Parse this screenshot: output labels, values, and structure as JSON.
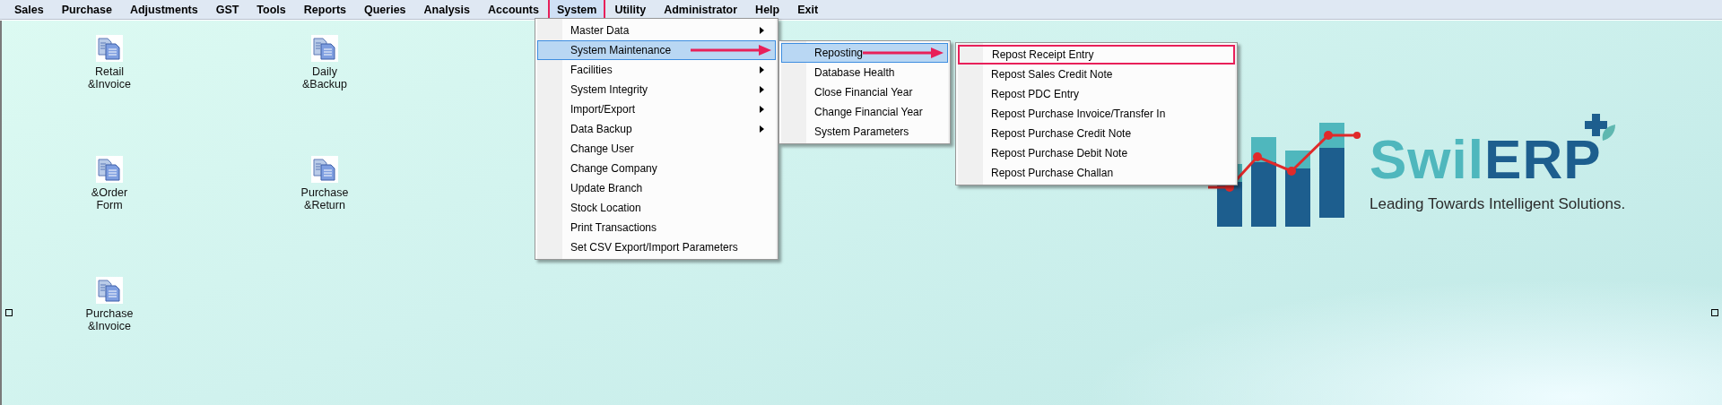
{
  "menubar": [
    {
      "label": "Sales",
      "selected": false,
      "annotated": false
    },
    {
      "label": "Purchase",
      "selected": false,
      "annotated": false
    },
    {
      "label": "Adjustments",
      "selected": false,
      "annotated": false
    },
    {
      "label": "GST",
      "selected": false,
      "annotated": false
    },
    {
      "label": "Tools",
      "selected": false,
      "annotated": false
    },
    {
      "label": "Reports",
      "selected": false,
      "annotated": false
    },
    {
      "label": "Queries",
      "selected": false,
      "annotated": false
    },
    {
      "label": "Analysis",
      "selected": false,
      "annotated": false
    },
    {
      "label": "Accounts",
      "selected": false,
      "annotated": false
    },
    {
      "label": "System",
      "selected": true,
      "annotated": true
    },
    {
      "label": "Utility",
      "selected": false,
      "annotated": false
    },
    {
      "label": "Administrator",
      "selected": false,
      "annotated": false
    },
    {
      "label": "Help",
      "selected": false,
      "annotated": false
    },
    {
      "label": "Exit",
      "selected": false,
      "annotated": false
    }
  ],
  "menus": [
    {
      "items": [
        {
          "label": "Master Data",
          "submenu": true,
          "selected": false,
          "annotated": false
        },
        {
          "label": "System Maintenance",
          "submenu": true,
          "selected": true,
          "annotated": false
        },
        {
          "label": "Facilities",
          "submenu": true,
          "selected": false,
          "annotated": false
        },
        {
          "label": "System Integrity",
          "submenu": true,
          "selected": false,
          "annotated": false
        },
        {
          "label": "Import/Export",
          "submenu": true,
          "selected": false,
          "annotated": false
        },
        {
          "label": "Data Backup",
          "submenu": true,
          "selected": false,
          "annotated": false
        },
        {
          "label": "Change User",
          "submenu": false,
          "selected": false,
          "annotated": false
        },
        {
          "label": "Change Company",
          "submenu": false,
          "selected": false,
          "annotated": false
        },
        {
          "label": "Update Branch",
          "submenu": false,
          "selected": false,
          "annotated": false
        },
        {
          "label": "Stock Location",
          "submenu": false,
          "selected": false,
          "annotated": false
        },
        {
          "label": "Print Transactions",
          "submenu": false,
          "selected": false,
          "annotated": false
        },
        {
          "label": "Set CSV Export/Import Parameters",
          "submenu": false,
          "selected": false,
          "annotated": false
        }
      ]
    },
    {
      "items": [
        {
          "label": "Reposting",
          "submenu": true,
          "selected": true,
          "annotated": false
        },
        {
          "label": "Database Health",
          "submenu": false,
          "selected": false,
          "annotated": false
        },
        {
          "label": "Close Financial Year",
          "submenu": false,
          "selected": false,
          "annotated": false
        },
        {
          "label": "Change Financial Year",
          "submenu": false,
          "selected": false,
          "annotated": false
        },
        {
          "label": "System Parameters",
          "submenu": false,
          "selected": false,
          "annotated": false
        }
      ]
    },
    {
      "items": [
        {
          "label": "Repost Receipt Entry",
          "submenu": false,
          "selected": false,
          "annotated": true
        },
        {
          "label": "Repost Sales Credit Note",
          "submenu": false,
          "selected": false,
          "annotated": false
        },
        {
          "label": "Repost PDC Entry",
          "submenu": false,
          "selected": false,
          "annotated": false
        },
        {
          "label": "Repost Purchase Invoice/Transfer In",
          "submenu": false,
          "selected": false,
          "annotated": false
        },
        {
          "label": "Repost Purchase Credit Note",
          "submenu": false,
          "selected": false,
          "annotated": false
        },
        {
          "label": "Repost Purchase Debit Note",
          "submenu": false,
          "selected": false,
          "annotated": false
        },
        {
          "label": "Repost Purchase Challan",
          "submenu": false,
          "selected": false,
          "annotated": false
        }
      ]
    }
  ],
  "desktop_icons": [
    {
      "label": "Retail\n&Invoice"
    },
    {
      "label": "&Order\nForm"
    },
    {
      "label": "Purchase\n&Invoice"
    },
    {
      "label": "Daily\n&Backup"
    },
    {
      "label": "Purchase\n&Return"
    }
  ],
  "logo": {
    "brand_light": "Swil",
    "brand_dark": "ERP",
    "tagline": "Leading Towards Intelligent Solutions."
  }
}
